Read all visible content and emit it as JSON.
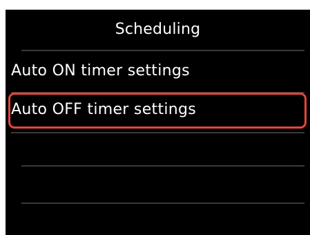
{
  "screen": {
    "title": "Scheduling",
    "items": [
      {
        "label": "Auto ON timer settings",
        "selected": false
      },
      {
        "label": "Auto OFF timer settings",
        "selected": true
      }
    ],
    "colors": {
      "background": "#000000",
      "text": "#ffffff",
      "selection_border": "#e8453c",
      "divider": "#3a3a3a"
    }
  }
}
